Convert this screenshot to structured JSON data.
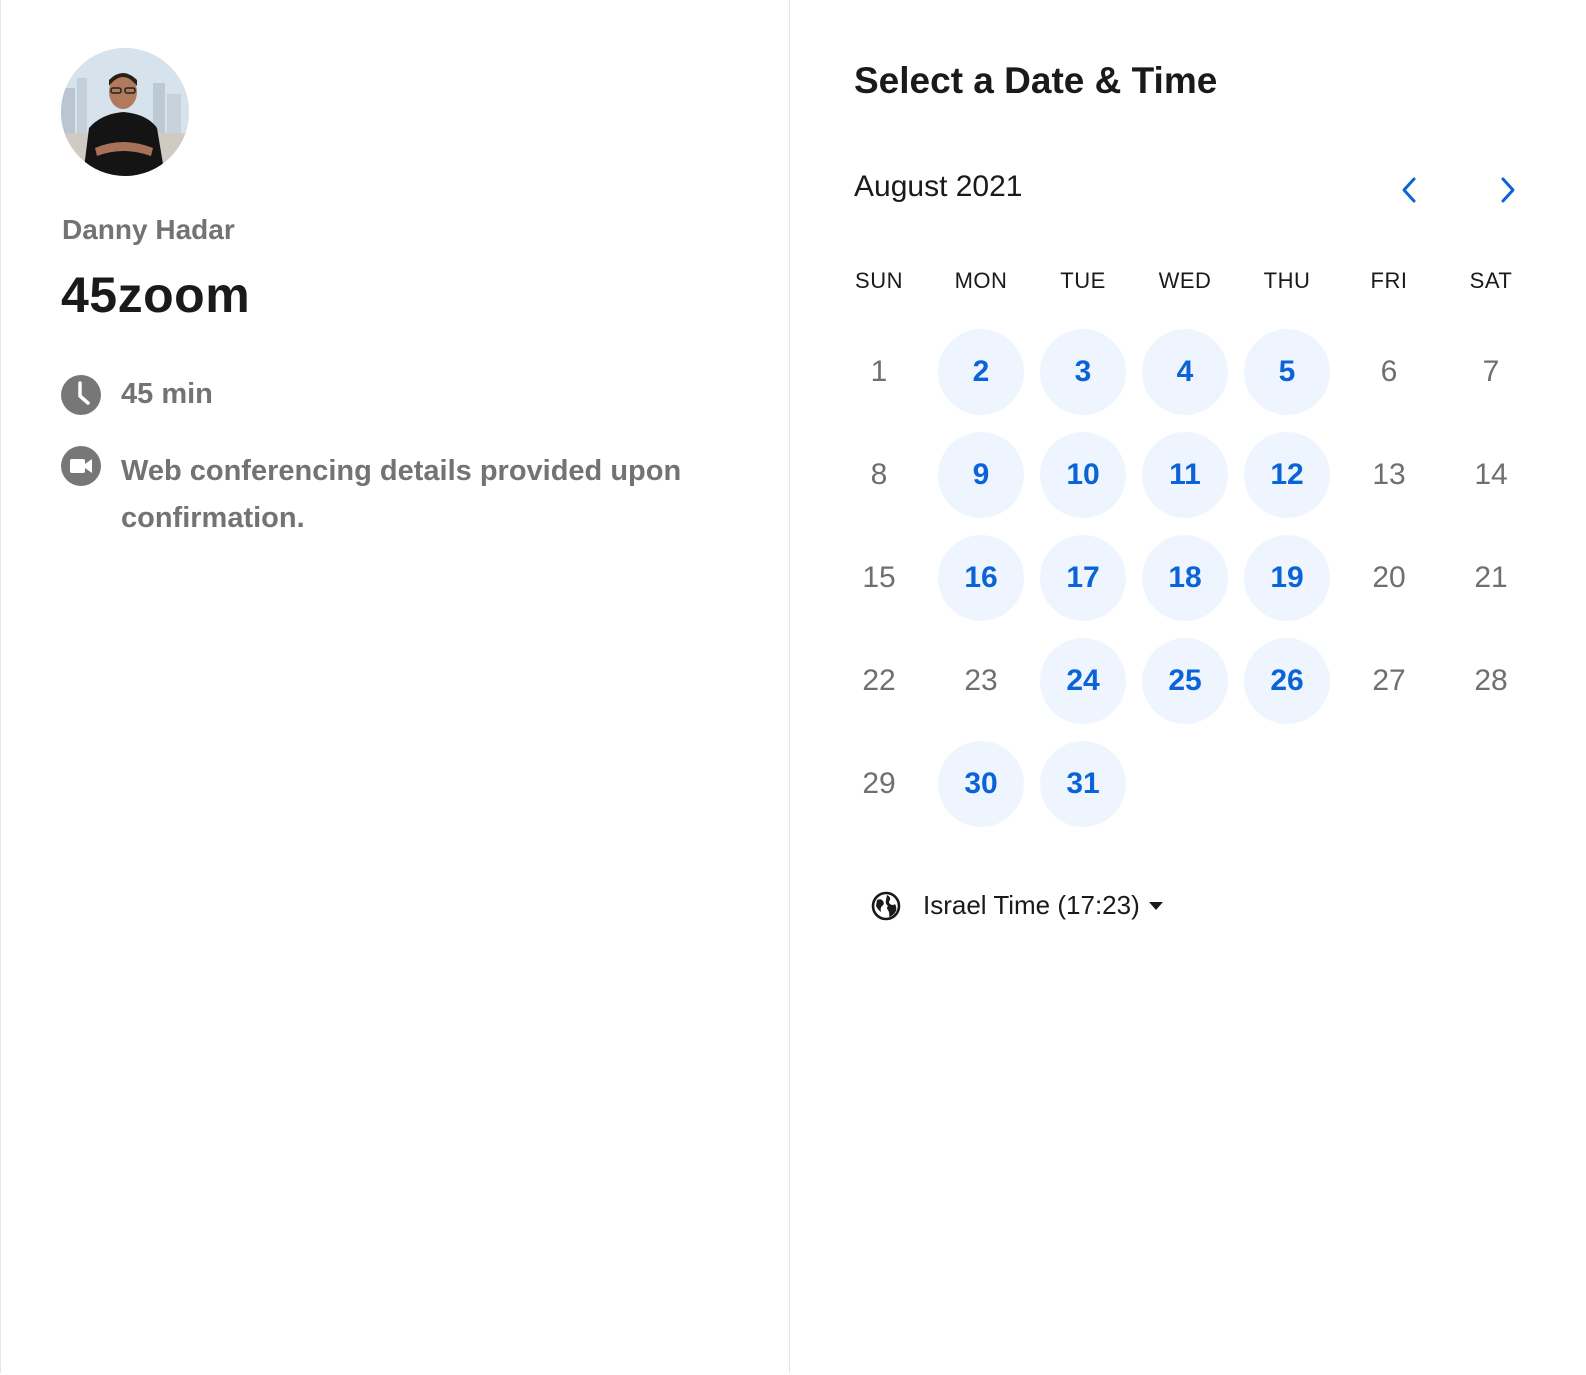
{
  "event": {
    "owner_name": "Danny Hadar",
    "title": "45zoom",
    "duration": "45 min",
    "conferencing": "Web conferencing details provided upon confirmation."
  },
  "calendar": {
    "heading": "Select a Date & Time",
    "month_label": "August 2021",
    "weekdays": [
      "SUN",
      "MON",
      "TUE",
      "WED",
      "THU",
      "FRI",
      "SAT"
    ],
    "days": [
      {
        "d": "1",
        "available": false
      },
      {
        "d": "2",
        "available": true
      },
      {
        "d": "3",
        "available": true
      },
      {
        "d": "4",
        "available": true
      },
      {
        "d": "5",
        "available": true
      },
      {
        "d": "6",
        "available": false
      },
      {
        "d": "7",
        "available": false
      },
      {
        "d": "8",
        "available": false
      },
      {
        "d": "9",
        "available": true
      },
      {
        "d": "10",
        "available": true
      },
      {
        "d": "11",
        "available": true
      },
      {
        "d": "12",
        "available": true
      },
      {
        "d": "13",
        "available": false
      },
      {
        "d": "14",
        "available": false
      },
      {
        "d": "15",
        "available": false
      },
      {
        "d": "16",
        "available": true
      },
      {
        "d": "17",
        "available": true
      },
      {
        "d": "18",
        "available": true
      },
      {
        "d": "19",
        "available": true
      },
      {
        "d": "20",
        "available": false
      },
      {
        "d": "21",
        "available": false
      },
      {
        "d": "22",
        "available": false
      },
      {
        "d": "23",
        "available": false
      },
      {
        "d": "24",
        "available": true
      },
      {
        "d": "25",
        "available": true
      },
      {
        "d": "26",
        "available": true
      },
      {
        "d": "27",
        "available": false
      },
      {
        "d": "28",
        "available": false
      },
      {
        "d": "29",
        "available": false
      },
      {
        "d": "30",
        "available": true
      },
      {
        "d": "31",
        "available": true
      }
    ],
    "timezone": "Israel Time (17:23)"
  },
  "icons": {
    "duration": "clock-icon",
    "conferencing": "video-camera-icon",
    "timezone": "globe-icon",
    "prev": "chevron-left-icon",
    "next": "chevron-right-icon"
  },
  "colors": {
    "accent": "#0b63d8",
    "available_bg": "#eff5fe",
    "muted_text": "#737373",
    "icon_gray": "#777777"
  }
}
